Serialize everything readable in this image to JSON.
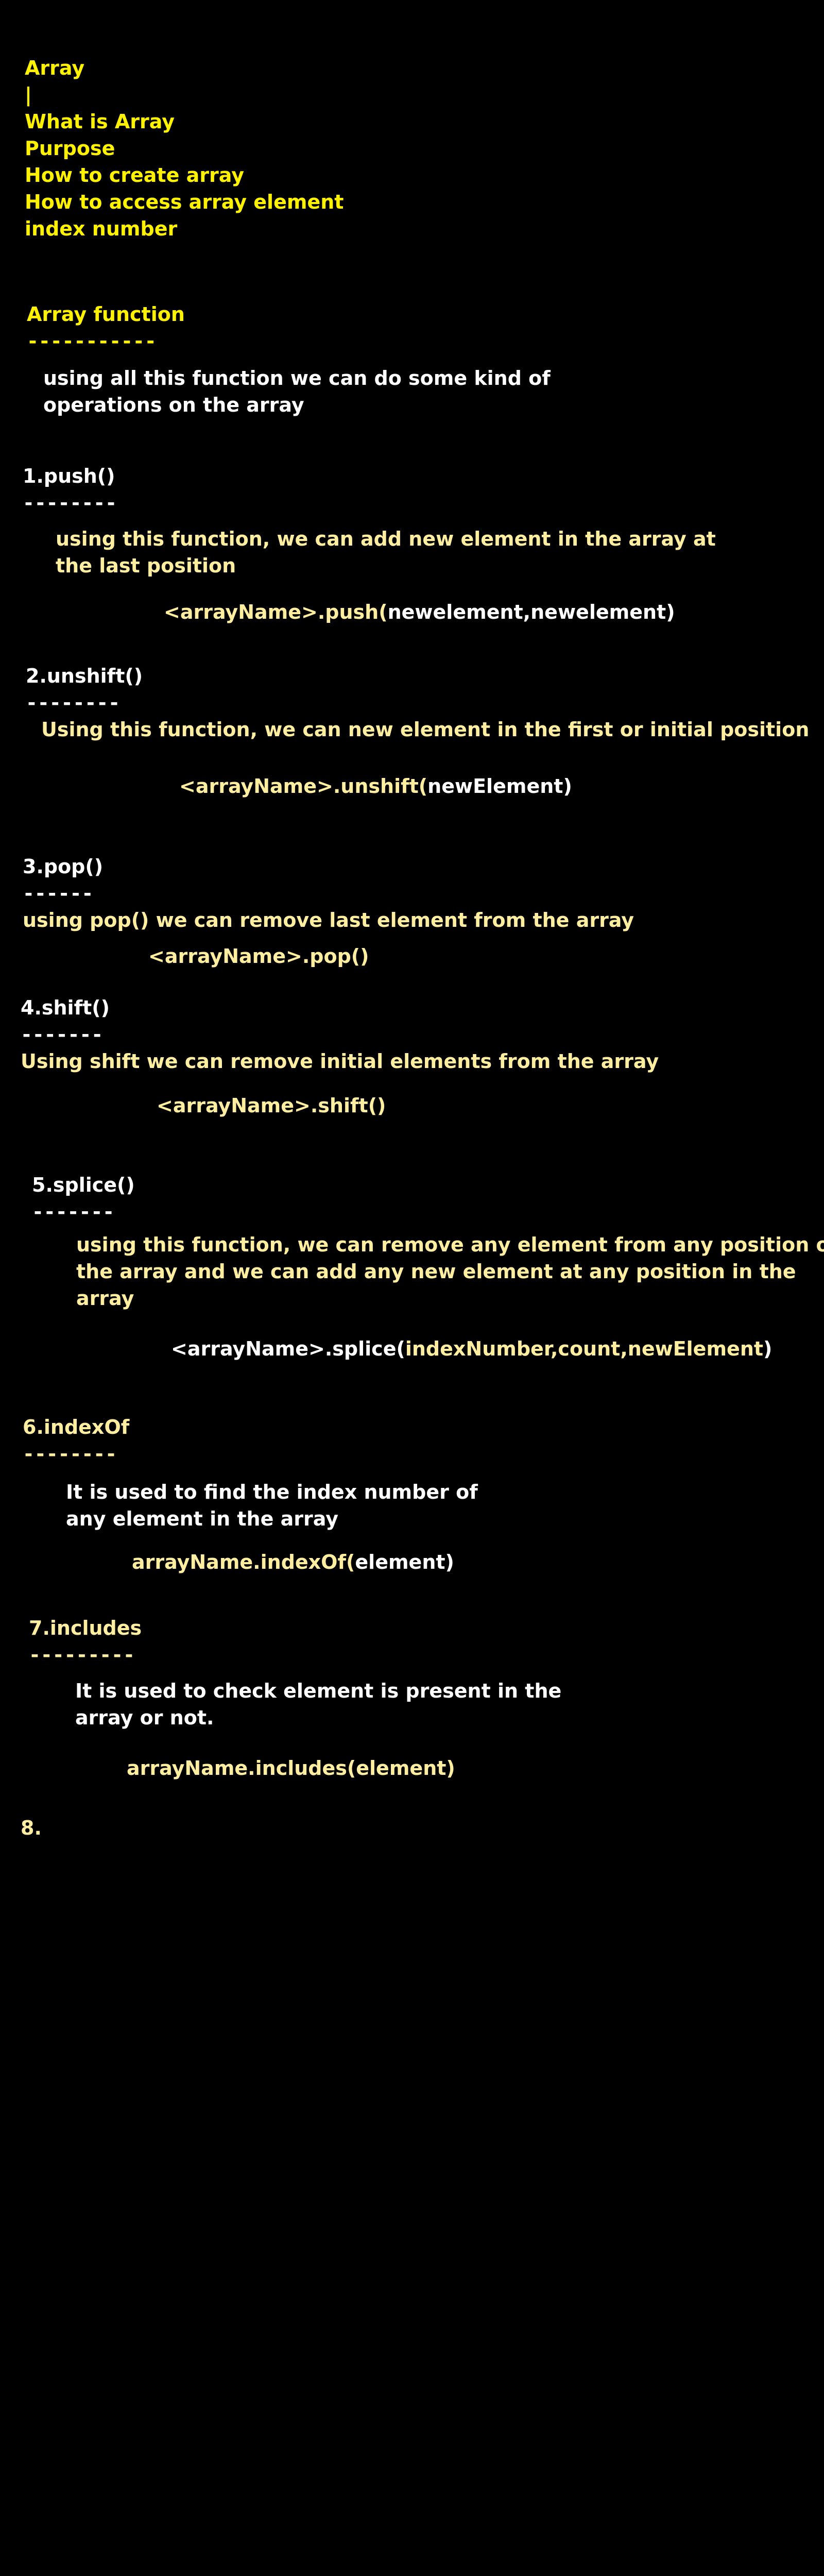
{
  "colors": {
    "background": "#000000",
    "yellow": "#fff200",
    "cream": "#ffeea0",
    "white": "#ffffff"
  },
  "intro": {
    "title": "Array",
    "bar": "|",
    "items": [
      "What is Array",
      "Purpose",
      "How to create array",
      "How to access array element",
      "index number"
    ]
  },
  "functions": {
    "heading": "Array function",
    "underline": "-----------",
    "desc_line1": "using all this function we can do some kind of",
    "desc_line2": "operations on the array"
  },
  "push": {
    "heading": "1.push()",
    "underline": "--------",
    "desc_line1": "using this function, we can add new element in the array at",
    "desc_line2": "the last position",
    "syntax_a": "<arrayName>.push(",
    "syntax_b": "newelement,newelement)"
  },
  "unshift": {
    "heading": "2.unshift()",
    "underline": "--------",
    "desc": "Using this function, we can new element in the first or initial position",
    "syntax_a": "<arrayName>.unshift(",
    "syntax_b": "newElement)"
  },
  "pop": {
    "heading": "3.pop()",
    "underline": "------",
    "desc": "using pop() we can remove last element from the array",
    "syntax": "<arrayName>.pop()"
  },
  "shift": {
    "heading": "4.shift()",
    "underline": "-------",
    "desc": "Using shift we can remove initial elements from the array",
    "syntax": "<arrayName>.shift()"
  },
  "splice": {
    "heading": "5.splice()",
    "underline": "-------",
    "desc_line1": "using this function, we can remove any element from any position of",
    "desc_line2": "the array and we can add any new element at any position in the",
    "desc_line3": "array",
    "syntax_a": "<arrayName>.splice(",
    "syntax_b": "indexNumber,count,newElement",
    "syntax_c": ")"
  },
  "indexof": {
    "heading": "6.indexOf",
    "underline": "--------",
    "desc_line1": "It is used to find the index number of",
    "desc_line2": "any element in the array",
    "syntax_a": "arrayName.indexOf(",
    "syntax_b": "element)"
  },
  "includes": {
    "heading": "7.includes",
    "underline": "---------",
    "desc_line1": "It is used to check element is present in the",
    "desc_line2": "array or not.",
    "syntax": "arrayName.includes(element)"
  },
  "eight": {
    "heading": "8."
  }
}
